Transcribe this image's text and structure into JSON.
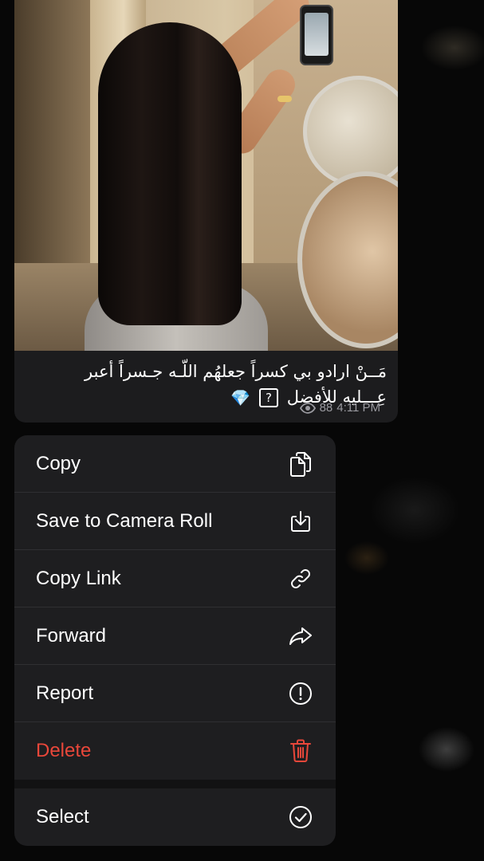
{
  "message": {
    "caption_line1": "مَــنْ ارادو بي كسراً جعلهُم اللّـه جـسراً أعبر",
    "caption_line2_text": "عِـــليه للأفضل",
    "caption_box_glyph": "?",
    "caption_emoji": "💎",
    "views": "88",
    "time": "4:11 PM"
  },
  "menu": {
    "items": [
      {
        "label": "Copy",
        "icon": "copy-icon"
      },
      {
        "label": "Save to Camera Roll",
        "icon": "save-download-icon"
      },
      {
        "label": "Copy Link",
        "icon": "link-icon"
      },
      {
        "label": "Forward",
        "icon": "forward-arrow-icon"
      },
      {
        "label": "Report",
        "icon": "exclamation-circle-icon"
      },
      {
        "label": "Delete",
        "icon": "trash-icon",
        "destructive": true
      },
      {
        "label": "Select",
        "icon": "check-circle-icon"
      }
    ]
  },
  "colors": {
    "menu_background": "#1e1e20",
    "destructive": "#e9473a",
    "meta_text": "#9a9aa0",
    "bubble": "#1c1c1e"
  }
}
